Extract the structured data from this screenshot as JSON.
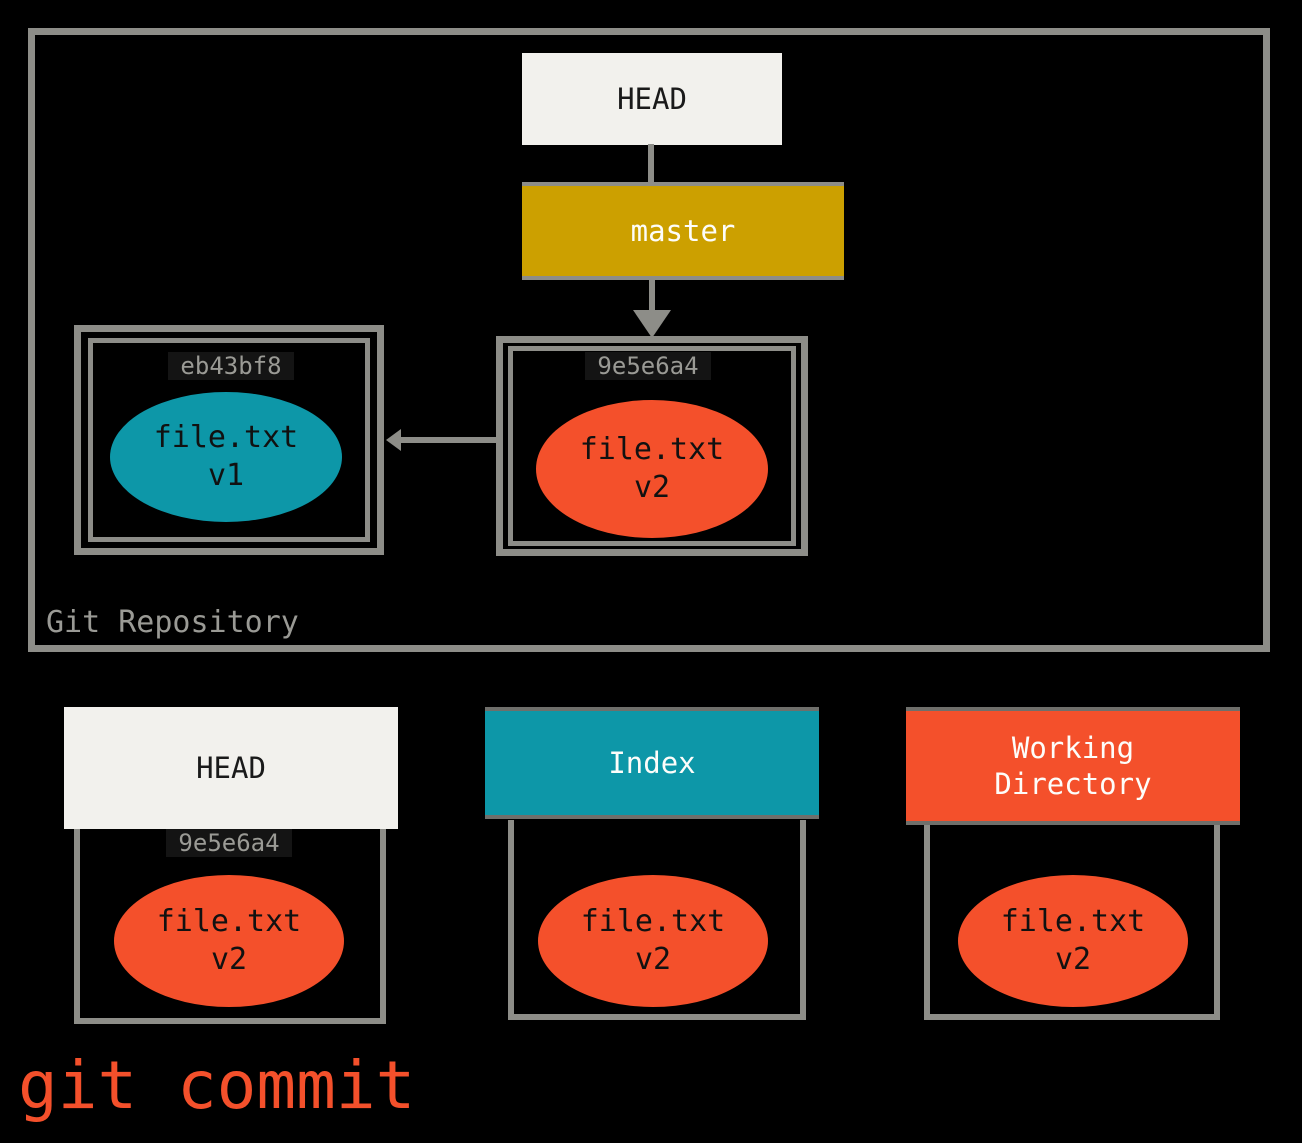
{
  "diagram": {
    "command_caption": "git commit",
    "repository": {
      "label": "Git Repository",
      "head_ref": "HEAD",
      "branch_ref": "master",
      "commits": [
        {
          "hash": "eb43bf8",
          "file_name": "file.txt",
          "file_version": "v1",
          "blob_color": "#0d97a8"
        },
        {
          "hash": "9e5e6a4",
          "file_name": "file.txt",
          "file_version": "v2",
          "blob_color": "#f4502b"
        }
      ]
    },
    "areas": [
      {
        "title": "HEAD",
        "hash": "9e5e6a4",
        "file_name": "file.txt",
        "file_version": "v2",
        "header_color": "#f2f1ed",
        "blob_color": "#f4502b"
      },
      {
        "title": "Index",
        "hash": "",
        "file_name": "file.txt",
        "file_version": "v2",
        "header_color": "#0d97a8",
        "blob_color": "#f4502b"
      },
      {
        "title_line1": "Working",
        "title_line2": "Directory",
        "hash": "",
        "file_name": "file.txt",
        "file_version": "v2",
        "header_color": "#f4502b",
        "blob_color": "#f4502b"
      }
    ],
    "colors": {
      "background": "#000000",
      "frame_gray": "#8d8d88",
      "branch_gold": "#ccA000",
      "teal": "#0d97a8",
      "orange": "#f4502b",
      "light_box": "#f2f1ed",
      "label_gray": "#9a9a95"
    }
  }
}
